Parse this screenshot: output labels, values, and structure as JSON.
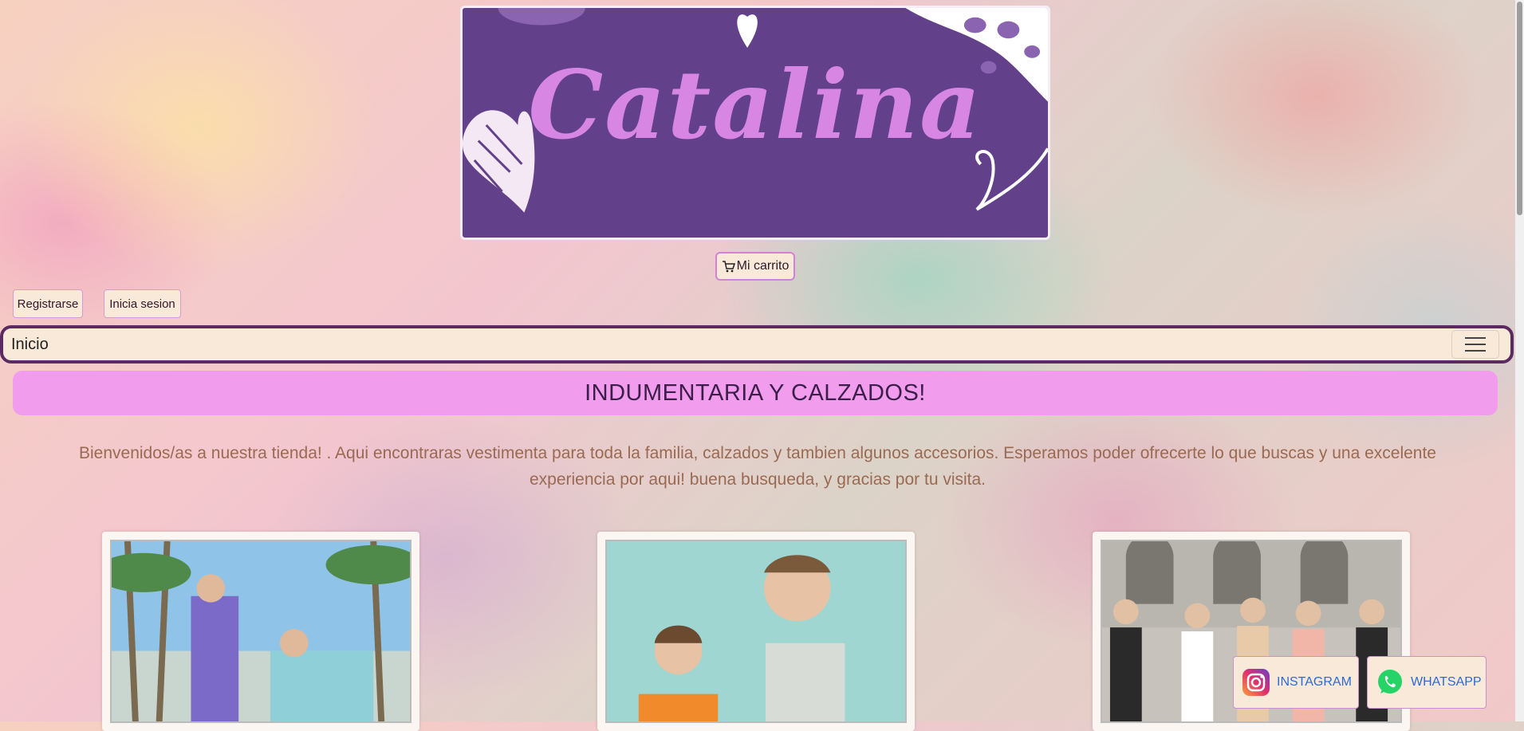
{
  "banner": {
    "title": "Catalina"
  },
  "cart": {
    "label": "Mi carrito",
    "icon": "cart-icon"
  },
  "auth": {
    "register_label": "Registrarse",
    "login_label": "Inicia sesion"
  },
  "nav": {
    "home_label": "Inicio",
    "toggle_icon": "hamburger-menu-icon"
  },
  "main": {
    "headline": "INDUMENTARIA Y CALZADOS!",
    "welcome": "Bienvenidos/as a nuestra tienda! . Aqui encontraras vestimenta para toda la familia, calzados y tambien algunos accesorios. Esperamos poder ofrecerte lo que buscas y una excelente experiencia por aqui! buena busqueda, y gracias por tu visita."
  },
  "social": {
    "instagram_label": "INSTAGRAM",
    "whatsapp_label": "WHATSAPP"
  },
  "colors": {
    "banner_bg": "#63418a",
    "banner_text": "#d886e3",
    "headline_bg": "#f29ced",
    "nav_border": "#5b2a60",
    "button_bg": "#f9e9d8",
    "link": "#2c6ad8"
  }
}
